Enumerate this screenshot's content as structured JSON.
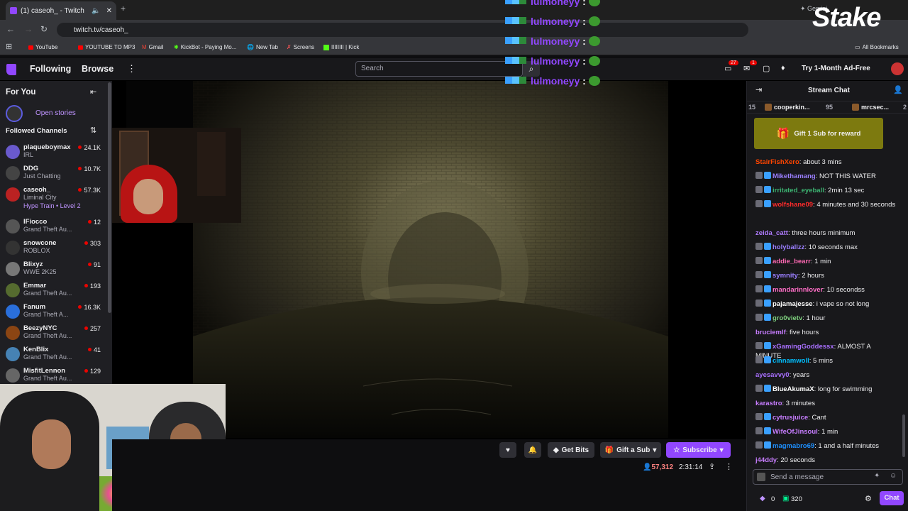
{
  "browser": {
    "tab_title": "(1) caseoh_ - Twitch",
    "url": "twitch.tv/caseoh_",
    "bookmarks": [
      "YouTube",
      "YOUTUBE TO MP3",
      "Gmail",
      "KickBot - Paying Mo...",
      "New Tab",
      "Screens",
      "IIIIIIII | Kick"
    ],
    "all_bookmarks": "All Bookmarks",
    "gemini": "Gemini"
  },
  "overlay": {
    "sponsor": "Stake",
    "repeated_name": "lulmoneyy",
    "separator": ":"
  },
  "twitch_nav": {
    "following": "Following",
    "browse": "Browse",
    "search_placeholder": "Search",
    "notif_count": "27",
    "whisper_count": "1",
    "ad_free": "Try 1-Month Ad-Free"
  },
  "sidebar": {
    "for_you": "For You",
    "open_stories": "Open stories",
    "followed_channels": "Followed Channels",
    "channels": [
      {
        "name": "plaqueboymax",
        "game": "IRL",
        "viewers": "24.1K",
        "color": "#6a5acd"
      },
      {
        "name": "DDG",
        "game": "Just Chatting",
        "viewers": "10.7K",
        "color": "#444"
      },
      {
        "name": "caseoh_",
        "game": "Liminal City",
        "viewers": "57.3K",
        "color": "#b22"
      },
      {
        "name": "lFiocco",
        "game": "Grand Theft Au...",
        "viewers": "12",
        "color": "#555"
      },
      {
        "name": "snowcone",
        "game": "ROBLOX",
        "viewers": "303",
        "color": "#333"
      },
      {
        "name": "Blixyz",
        "game": "WWE 2K25",
        "viewers": "91",
        "color": "#777"
      },
      {
        "name": "Emmar",
        "game": "Grand Theft Au...",
        "viewers": "193",
        "color": "#556b2f"
      },
      {
        "name": "Fanum",
        "game": "Grand Theft A...",
        "viewers": "16.3K",
        "color": "#2a6fdb"
      },
      {
        "name": "BeezyNYC",
        "game": "Grand Theft Au...",
        "viewers": "257",
        "color": "#8b4513"
      },
      {
        "name": "KenBlix",
        "game": "Grand Theft Au...",
        "viewers": "41",
        "color": "#4682b4"
      },
      {
        "name": "MisfitLennon",
        "game": "Grand Theft Au...",
        "viewers": "129",
        "color": "#666"
      }
    ],
    "hype_train": "Hype Train • Level 2"
  },
  "player": {
    "get_bits": "Get Bits",
    "gift_sub": "Gift a Sub",
    "subscribe": "Subscribe",
    "viewers": "57,312",
    "uptime": "2:31:14"
  },
  "chat": {
    "title": "Stream Chat",
    "leaders": [
      {
        "rank": "15",
        "name": "",
        "points": ""
      },
      {
        "rank": "",
        "name": "cooperkin...",
        "points": "95"
      },
      {
        "rank": "",
        "name": "mrcsec...",
        "points": "2"
      }
    ],
    "gift_reward": "Gift 1 Sub for reward",
    "messages": [
      {
        "user": "StairFishXero",
        "text": "about 3 mins",
        "color": "#ff4500"
      },
      {
        "user": "Mikethamang",
        "text": "NOT THIS WATER",
        "color": "#9b7fff"
      },
      {
        "user": "irritated_eyeball",
        "text": "2min 13 sec",
        "color": "#3cb371"
      },
      {
        "user": "wolfshane09",
        "text": "4 minutes and 30 seconds",
        "color": "#ff2b2b"
      },
      {
        "user": "zeida_catt",
        "text": "three hours minimum",
        "color": "#b07cff"
      },
      {
        "user": "holyballzz",
        "text": "10 seconds max",
        "color": "#9b7fff"
      },
      {
        "user": "addie_bearr",
        "text": "1 min",
        "color": "#ff69b4"
      },
      {
        "user": "symnity",
        "text": "2 hours",
        "color": "#9b7fff"
      },
      {
        "user": "mandarinnlover",
        "text": "10 secondss",
        "color": "#ff6ec7"
      },
      {
        "user": "pajamajesse",
        "text": "i vape so not long",
        "color": "#ffffff"
      },
      {
        "user": "gro0vietv",
        "text": "1 hour",
        "color": "#7fd17f"
      },
      {
        "user": "bruciemlf",
        "text": "five hours",
        "color": "#c77dff"
      },
      {
        "user": "xGamingGoddessx",
        "text": "ALMOST A MINUTE",
        "color": "#a970ff"
      },
      {
        "user": "cinnamwoll",
        "text": "5 mins",
        "color": "#00bfff"
      },
      {
        "user": "ayesavvy0",
        "text": "years",
        "color": "#a970ff"
      },
      {
        "user": "BlueAkumaX",
        "text": "long for swimming",
        "color": "#ffffff"
      },
      {
        "user": "karastro",
        "text": "3 minutes",
        "color": "#c77dff"
      },
      {
        "user": "cytrusjuice",
        "text": "Cant",
        "color": "#c77dff"
      },
      {
        "user": "WifeOfJinsoul",
        "text": "1 min",
        "color": "#c77dff"
      },
      {
        "user": "magmabro69",
        "text": "1 and a half minutes",
        "color": "#1e90ff"
      },
      {
        "user": "j44ddy",
        "text": "20 seconds",
        "color": "#c77dff"
      }
    ],
    "input_placeholder": "Send a message",
    "bits_count": "0",
    "points": "320",
    "chat_button": "Chat"
  }
}
